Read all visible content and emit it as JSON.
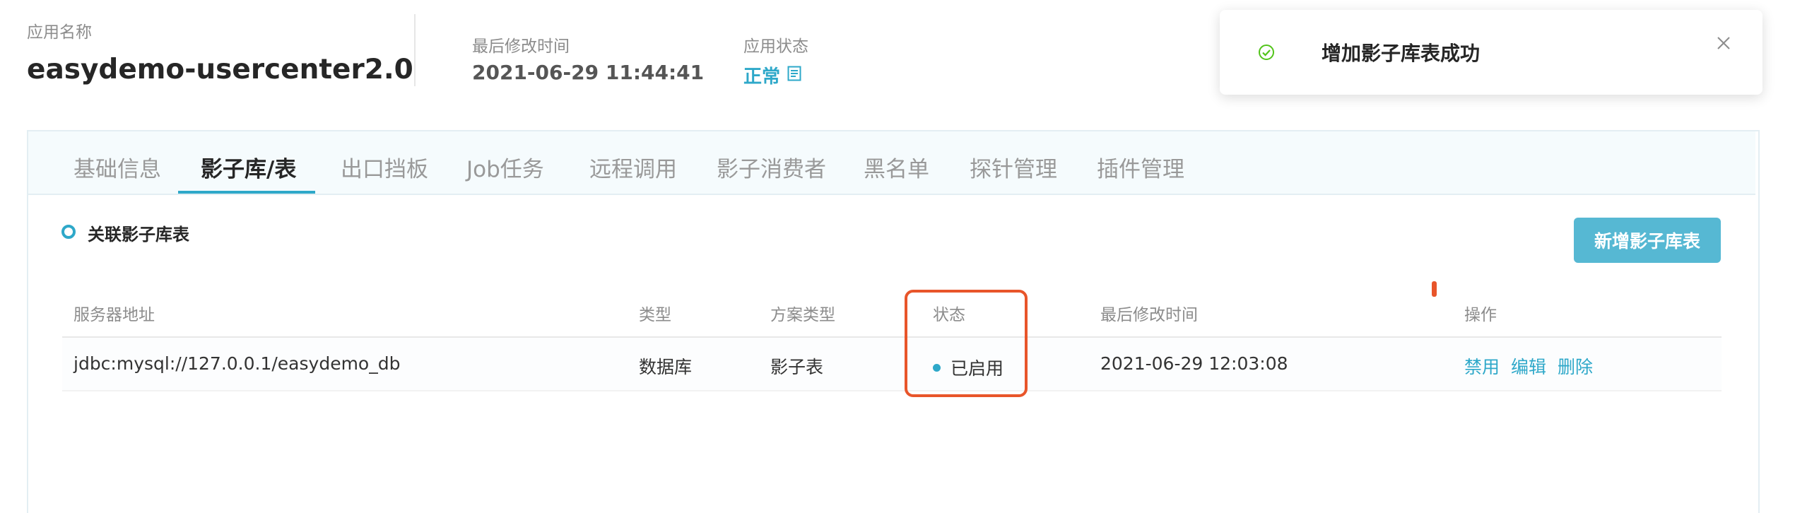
{
  "header": {
    "app_name_label": "应用名称",
    "app_name": "easydemo-usercenter2.0",
    "modified_label": "最后修改时间",
    "modified_value": "2021-06-29 11:44:41",
    "status_label": "应用状态",
    "status_value": "正常",
    "status_color": "#2ea8c9"
  },
  "tabs": [
    {
      "label": "基础信息"
    },
    {
      "label": "影子库/表",
      "active": true
    },
    {
      "label": "出口挡板"
    },
    {
      "label": "Job任务"
    },
    {
      "label": "远程调用"
    },
    {
      "label": "影子消费者"
    },
    {
      "label": "黑名单"
    },
    {
      "label": "探针管理"
    },
    {
      "label": "插件管理"
    }
  ],
  "section": {
    "title": "关联影子库表",
    "add_button": "新增影子库表"
  },
  "table": {
    "columns": [
      "服务器地址",
      "类型",
      "方案类型",
      "状态",
      "最后修改时间",
      "操作"
    ],
    "rows": [
      {
        "address": "jdbc:mysql://127.0.0.1/easydemo_db",
        "type": "数据库",
        "scheme": "影子表",
        "status": "已启用",
        "modified": "2021-06-29 12:03:08",
        "actions": [
          "禁用",
          "编辑",
          "删除"
        ]
      }
    ]
  },
  "toast": {
    "message": "增加影子库表成功",
    "icon": "success-check-icon"
  },
  "colors": {
    "accent": "#2ea8c9",
    "button": "#56b8d3",
    "highlight": "#e8552a"
  }
}
